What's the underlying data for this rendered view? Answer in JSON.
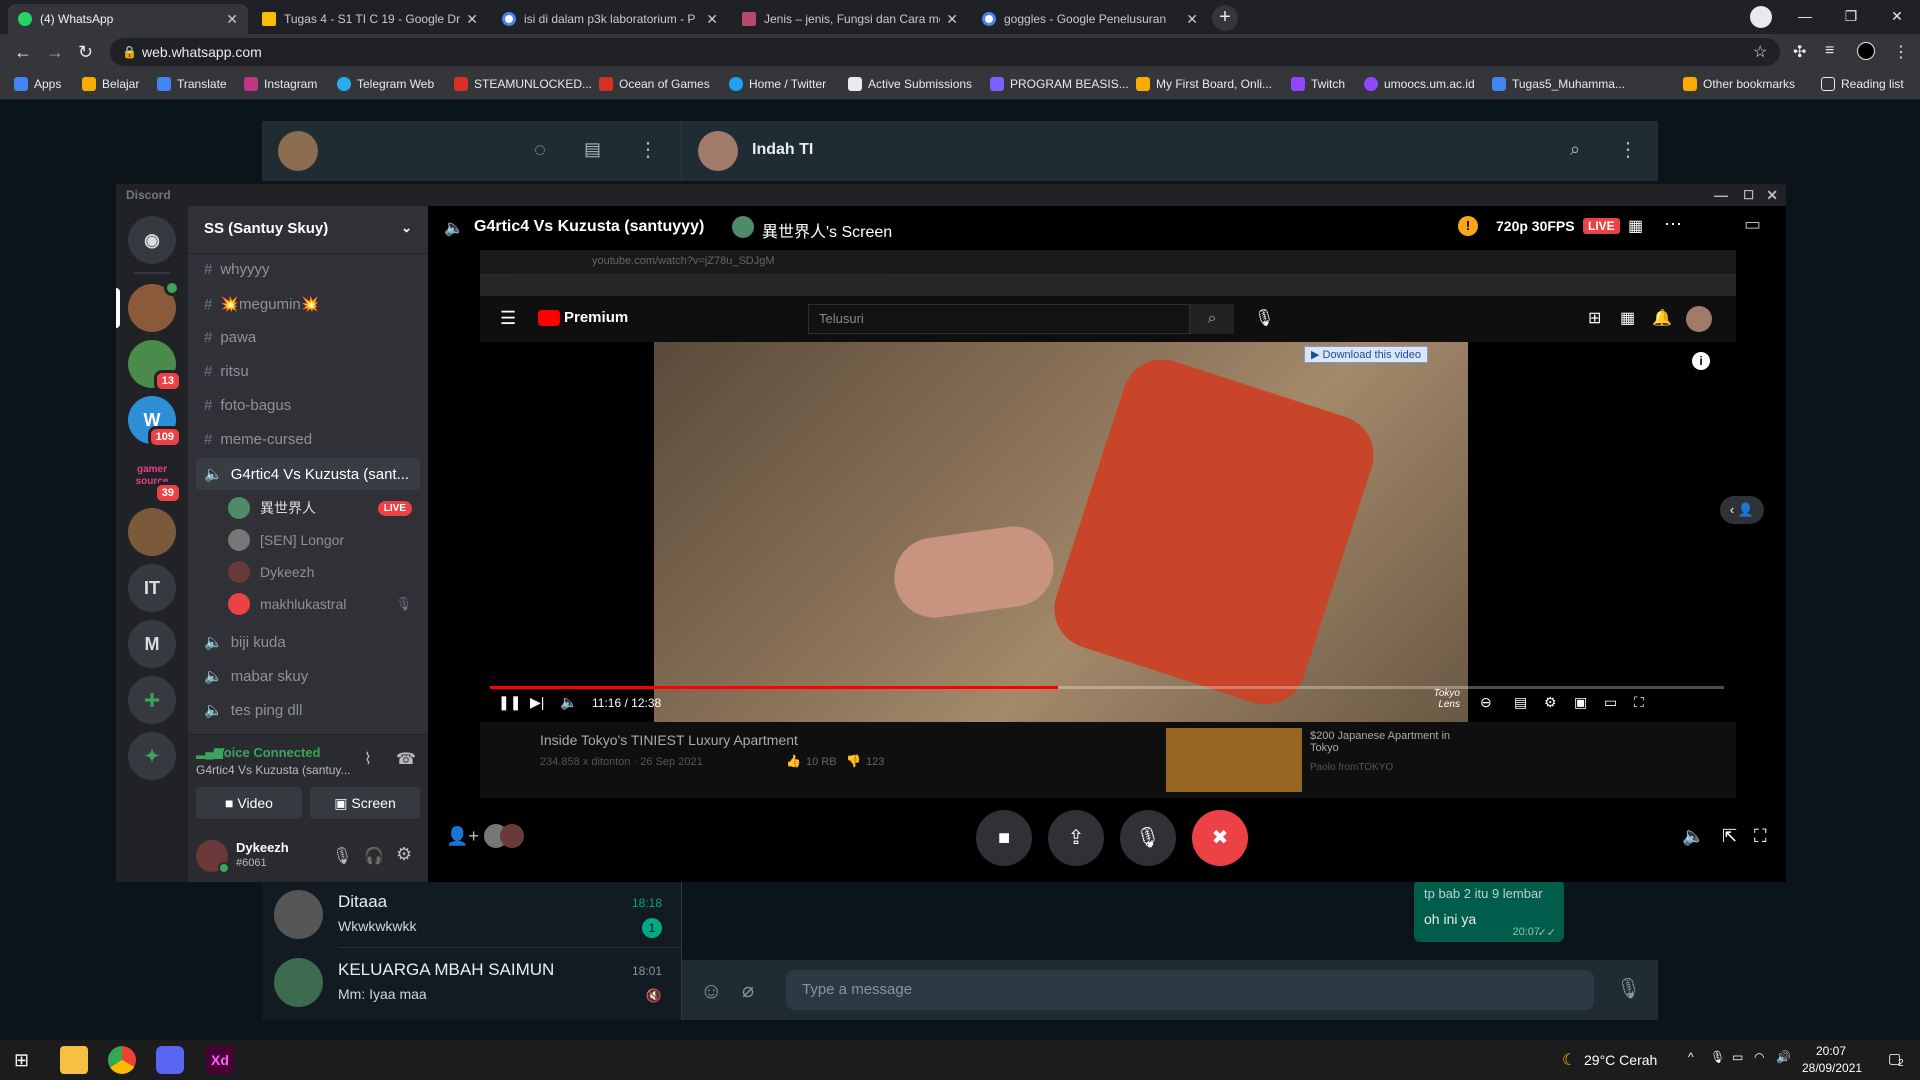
{
  "browser": {
    "tabs": [
      {
        "title": "(4) WhatsApp",
        "active": true,
        "color": "#25d366"
      },
      {
        "title": "Tugas 4 - S1 TI C 19 - Google Dr",
        "color": "#fbbc04"
      },
      {
        "title": "isi di dalam p3k laboratorium - P",
        "color": "#4285f4"
      },
      {
        "title": "Jenis – jenis, Fungsi dan Cara me",
        "color": "#b54a6d"
      },
      {
        "title": "goggles - Google Penelusuran",
        "color": "#4285f4"
      }
    ],
    "new_tab": "+",
    "url": "web.whatsapp.com",
    "bookmarks": [
      {
        "label": "Apps",
        "color": "#4285f4"
      },
      {
        "label": "Belajar",
        "color": "#f9ab00"
      },
      {
        "label": "Translate",
        "color": "#4285f4"
      },
      {
        "label": "Instagram",
        "color": "#c13584"
      },
      {
        "label": "Telegram Web",
        "color": "#2aabee"
      },
      {
        "label": "STEAMUNLOCKED...",
        "color": "#d93025"
      },
      {
        "label": "Ocean of Games",
        "color": "#d93025"
      },
      {
        "label": "Home / Twitter",
        "color": "#1da1f2"
      },
      {
        "label": "Active Submissions",
        "color": "#e8eaed"
      },
      {
        "label": "PROGRAM BEASIS...",
        "color": "#7b61ff"
      },
      {
        "label": "My First Board, Onli...",
        "color": "#f9ab00"
      },
      {
        "label": "Twitch",
        "color": "#9146ff"
      },
      {
        "label": "umoocs.um.ac.id",
        "color": "#9146ff"
      },
      {
        "label": "Tugas5_Muhamma...",
        "color": "#4285f4"
      },
      {
        "label": "Other bookmarks",
        "color": "#f9ab00"
      },
      {
        "label": "Reading list",
        "color": "#e8eaed"
      }
    ]
  },
  "whatsapp": {
    "contact_name": "Indah TI",
    "chats": [
      {
        "name": "Ditaaa",
        "message": "Wkwkwkwkk",
        "time": "18:18",
        "unread": "1"
      },
      {
        "name": "KELUARGA MBAH SAIMUN",
        "message": "Mm: Iyaa maa",
        "time": "18:01"
      }
    ],
    "bubbles": [
      {
        "text": "tp bab 2 itu 9 lembar"
      },
      {
        "text": "oh ini ya",
        "time": "20:07"
      }
    ],
    "input_placeholder": "Type a message"
  },
  "discord": {
    "window_title": "Discord",
    "server_name": "SS (Santuy Skuy)",
    "guild_badges": [
      "13",
      "109",
      "39"
    ],
    "guild_letters": [
      "IT",
      "M"
    ],
    "guild_logo_text": "gamer source",
    "channels": [
      "whyyyy",
      "💥megumin💥",
      "pawa",
      "ritsu",
      "foto-bagus",
      "meme-cursed"
    ],
    "voice_channel": "G4rtic4 Vs Kuzusta (sant...",
    "voice_users": [
      {
        "name": "異世界人",
        "live": "LIVE"
      },
      {
        "name": "[SEN] Longor"
      },
      {
        "name": "Dykeezh"
      },
      {
        "name": "makhlukastral"
      }
    ],
    "other_voice": [
      "biji kuda",
      "mabar skuy",
      "tes ping dll"
    ],
    "voice_connected": "Voice Connected",
    "voice_sub": "G4rtic4 Vs Kuzusta (santuy...",
    "video_btn": "Video",
    "screen_btn": "Screen",
    "username": "Dykeezh",
    "discriminator": "#6061",
    "stage_title": "G4rtic4 Vs Kuzusta (santuyyy)",
    "screen_owner": "異世界人's Screen",
    "quality": "720p 30FPS",
    "live": "LIVE"
  },
  "youtube": {
    "url": "youtube.com/watch?v=jZ78u_SDJgM",
    "brand": "Premium",
    "search_placeholder": "Telusuri",
    "download_label": "Download this video",
    "time": "11:16 / 12:38",
    "progress": 0.46,
    "video_title": "Inside Tokyo's TINIEST Luxury Apartment",
    "views": "234.858 x ditonton · 26 Sep 2021",
    "likes": "10 RB",
    "dislikes": "123",
    "rec_title": "$200 Japanese Apartment in Tokyo",
    "rec_channel": "Paolo fromTOKYO",
    "watermark": "Tokyo Lens"
  },
  "taskbar": {
    "weather": "29°C  Cerah",
    "time": "20:07",
    "date": "28/09/2021",
    "notif": "2"
  },
  "colors": {
    "discord_red": "#ed4245",
    "discord_green": "#3ba55d",
    "wa_green": "#00a884"
  }
}
